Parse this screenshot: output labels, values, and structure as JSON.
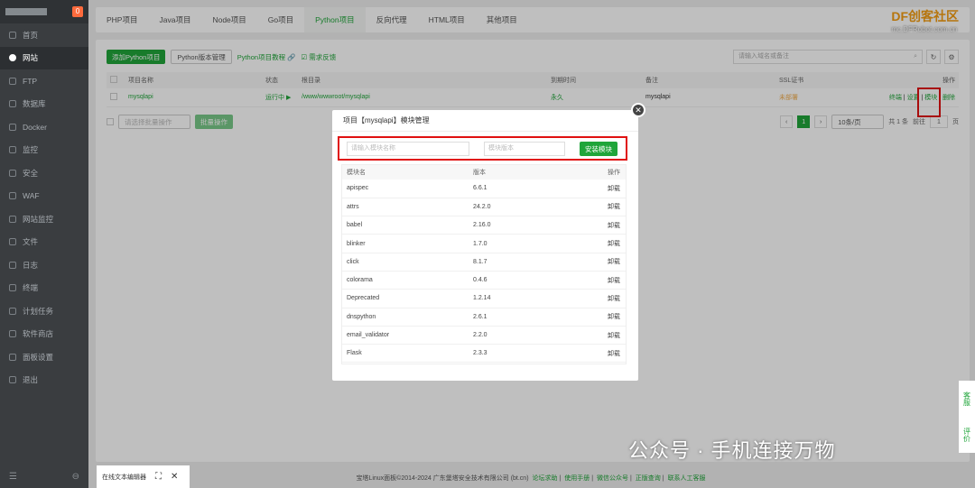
{
  "sidebar": {
    "badge": "0",
    "items": [
      {
        "label": "首页"
      },
      {
        "label": "网站"
      },
      {
        "label": "FTP"
      },
      {
        "label": "数据库"
      },
      {
        "label": "Docker"
      },
      {
        "label": "监控"
      },
      {
        "label": "安全"
      },
      {
        "label": "WAF"
      },
      {
        "label": "网站监控"
      },
      {
        "label": "文件"
      },
      {
        "label": "日志"
      },
      {
        "label": "终端"
      },
      {
        "label": "计划任务"
      },
      {
        "label": "软件商店"
      },
      {
        "label": "面板设置"
      },
      {
        "label": "退出"
      }
    ],
    "active_index": 1,
    "foot_left": "☰",
    "foot_right": "⊖"
  },
  "tabs": [
    "PHP项目",
    "Java项目",
    "Node项目",
    "Go项目",
    "Python项目",
    "反向代理",
    "HTML项目",
    "其他项目"
  ],
  "active_tab": 4,
  "brand": {
    "name": "DF创客社区",
    "url": "mc.DFRobot.com.cn"
  },
  "toolbar": {
    "add_button": "添加Python项目",
    "version_button": "Python版本管理",
    "tutorial_link": "Python项目教程 🔗",
    "feedback_link": "☑ 需求反馈",
    "search_placeholder": "请输入域名或备注"
  },
  "table": {
    "headers": [
      "项目名称",
      "状态",
      "根目录",
      "到期时间",
      "备注",
      "SSL证书",
      "操作"
    ],
    "row": {
      "name": "mysqlapi",
      "status": "运行中 ▶",
      "root": "/www/wwwroot/mysqlapi",
      "expire": "永久",
      "note": "mysqlapi",
      "ssl": "未部署",
      "actions": [
        "终端",
        "设置",
        "模块",
        "删除"
      ]
    }
  },
  "pager": {
    "batch_placeholder": "请选择批量操作",
    "batch_button": "批量操作",
    "prev": "‹",
    "current": "1",
    "next": "›",
    "per_page": "10条/页",
    "total": "共 1 条",
    "goto": "前往",
    "goto_value": "1",
    "page_suffix": "页"
  },
  "modal": {
    "title": "项目【mysqlapi】模块管理",
    "module_placeholder": "请输入模块名称",
    "version_placeholder": "模块版本",
    "install_button": "安装模块",
    "headers": [
      "模块名",
      "版本",
      "操作"
    ],
    "action_label": "卸载",
    "rows": [
      {
        "name": "apispec",
        "version": "6.6.1"
      },
      {
        "name": "attrs",
        "version": "24.2.0"
      },
      {
        "name": "babel",
        "version": "2.16.0"
      },
      {
        "name": "blinker",
        "version": "1.7.0"
      },
      {
        "name": "click",
        "version": "8.1.7"
      },
      {
        "name": "colorama",
        "version": "0.4.6"
      },
      {
        "name": "Deprecated",
        "version": "1.2.14"
      },
      {
        "name": "dnspython",
        "version": "2.6.1"
      },
      {
        "name": "email_validator",
        "version": "2.2.0"
      },
      {
        "name": "Flask",
        "version": "2.3.3"
      }
    ]
  },
  "footer": {
    "copyright": "宝塔Linux面板©2014-2024 广东堡塔安全技术有限公司 (bt.cn)",
    "links": [
      "论坛求助",
      "使用手册",
      "微信公众号",
      "正版查询",
      "联系人工客服"
    ]
  },
  "editor": {
    "label": "在线文本编辑器"
  },
  "side_float": [
    "客服",
    "评价"
  ],
  "watermark": "公众号 · 手机连接万物",
  "colors": {
    "accent": "#20a53a",
    "highlight": "#e01010",
    "sidebar": "#3a3d40"
  }
}
